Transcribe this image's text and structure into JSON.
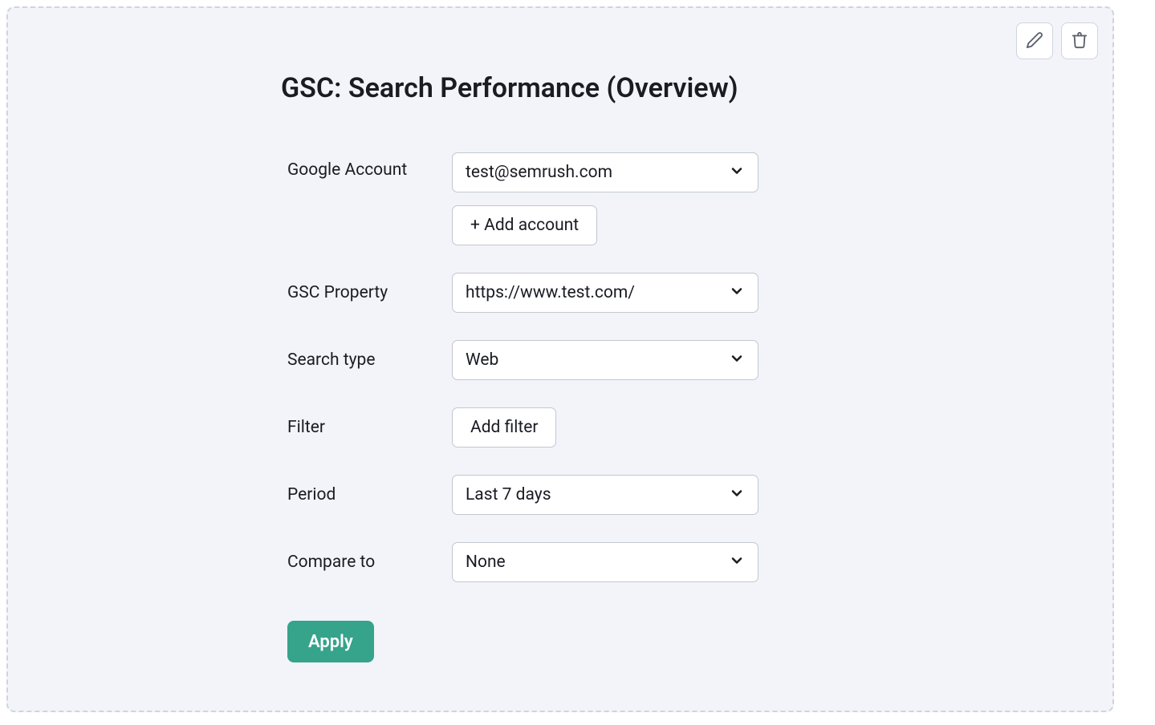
{
  "title": "GSC: Search Performance (Overview)",
  "form": {
    "google_account": {
      "label": "Google Account",
      "value": "test@semrush.com",
      "add_button": "+ Add account"
    },
    "gsc_property": {
      "label": "GSC Property",
      "value": "https://www.test.com/"
    },
    "search_type": {
      "label": "Search type",
      "value": "Web"
    },
    "filter": {
      "label": "Filter",
      "button": "Add filter"
    },
    "period": {
      "label": "Period",
      "value": "Last 7 days"
    },
    "compare_to": {
      "label": "Compare to",
      "value": "None"
    }
  },
  "buttons": {
    "apply": "Apply"
  }
}
